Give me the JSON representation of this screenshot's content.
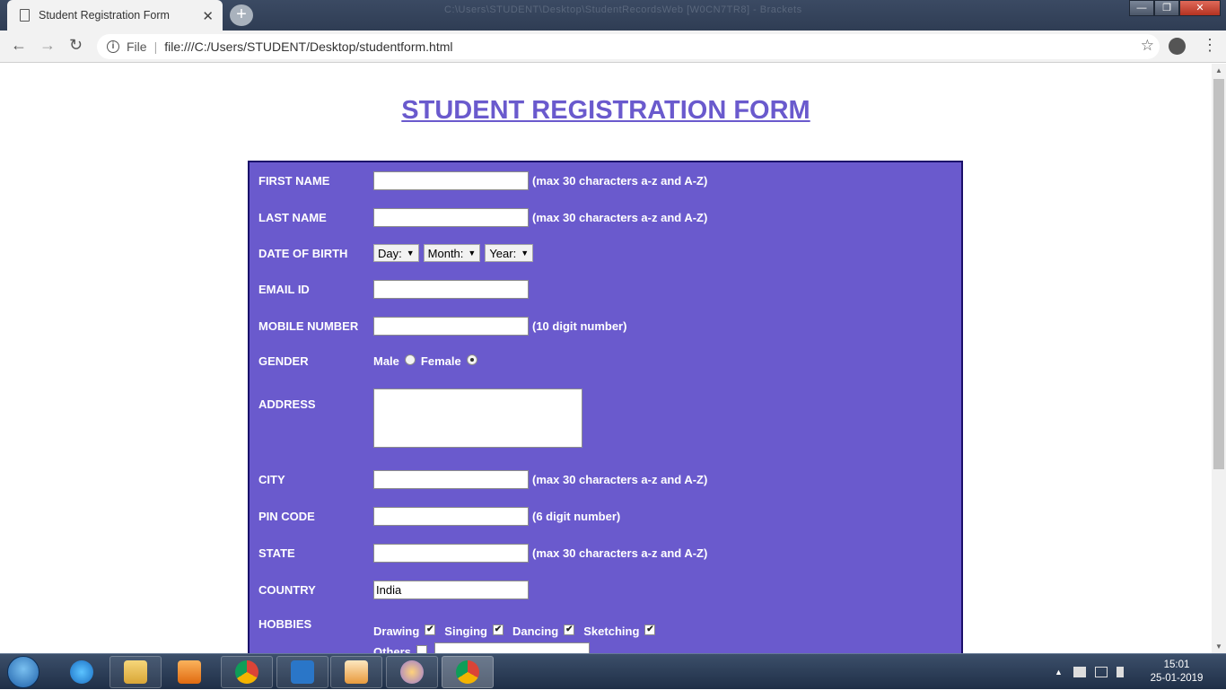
{
  "browser": {
    "tab_title": "Student Registration Form",
    "tab_close": "✕",
    "new_tab": "+",
    "window_title": "C:\\Users\\STUDENT\\Desktop\\StudentRecordsWeb [W0CN7TR8] - Brackets",
    "min_btn": "—",
    "max_btn": "❐",
    "close_btn": "✕",
    "back": "←",
    "forward": "→",
    "reload": "↻",
    "info_icon": "i",
    "file_label": "File",
    "separator": "|",
    "url": "file:///C:/Users/STUDENT/Desktop/studentform.html",
    "star": "☆",
    "menu": "⋮"
  },
  "page": {
    "heading": "STUDENT REGISTRATION FORM",
    "form": {
      "first_name": {
        "label": "FIRST NAME",
        "value": "",
        "hint": "(max 30 characters a-z and A-Z)"
      },
      "last_name": {
        "label": "LAST NAME",
        "value": "",
        "hint": "(max 30 characters a-z and A-Z)"
      },
      "dob": {
        "label": "DATE OF BIRTH",
        "day": "Day:",
        "month": "Month:",
        "year": "Year:",
        "arrow": "▼"
      },
      "email": {
        "label": "EMAIL ID",
        "value": ""
      },
      "mobile": {
        "label": "MOBILE NUMBER",
        "value": "",
        "hint": "(10 digit number)"
      },
      "gender": {
        "label": "GENDER",
        "male": "Male",
        "female": "Female",
        "selected": "Female"
      },
      "address": {
        "label": "ADDRESS",
        "value": ""
      },
      "city": {
        "label": "CITY",
        "value": "",
        "hint": "(max 30 characters a-z and A-Z)"
      },
      "pin": {
        "label": "PIN CODE",
        "value": "",
        "hint": "(6 digit number)"
      },
      "state": {
        "label": "STATE",
        "value": "",
        "hint": "(max 30 characters a-z and A-Z)"
      },
      "country": {
        "label": "COUNTRY",
        "value": "India"
      },
      "hobbies": {
        "label": "HOBBIES",
        "drawing": "Drawing",
        "singing": "Singing",
        "dancing": "Dancing",
        "sketching": "Sketching",
        "others": "Others",
        "check": "✔"
      }
    }
  },
  "scrollbar": {
    "up": "▲",
    "down": "▼"
  },
  "taskbar": {
    "time": "15:01",
    "date": "25-01-2019",
    "tray_arrow": "▲"
  },
  "colors": {
    "form_bg": "#6a5acd",
    "heading": "#6a5acd"
  }
}
